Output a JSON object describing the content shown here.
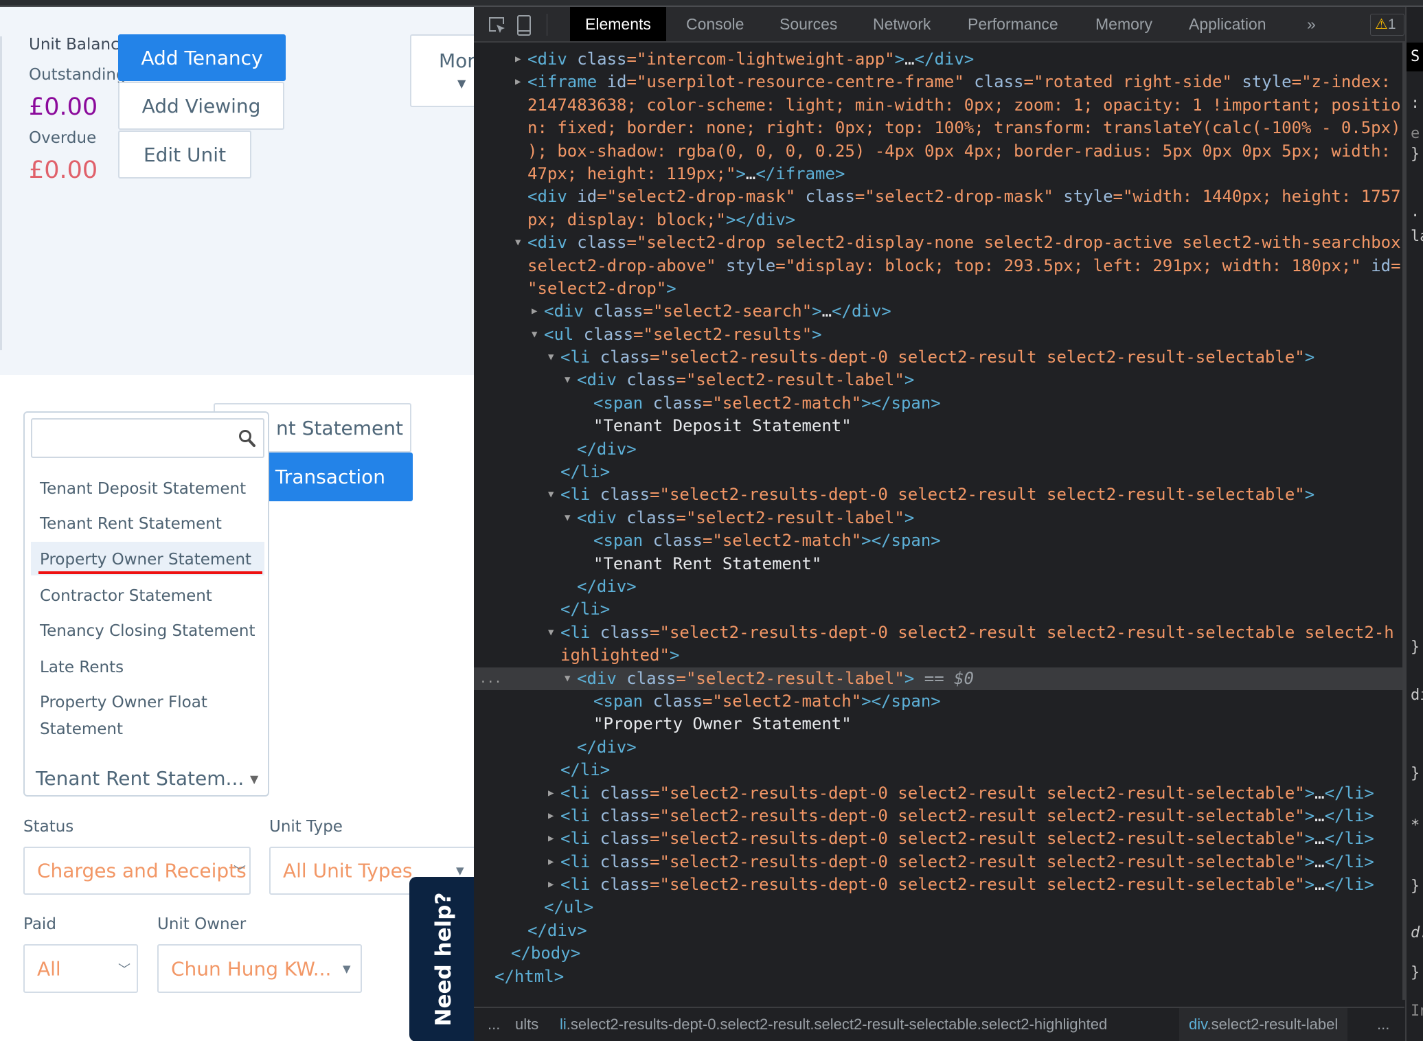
{
  "app": {
    "unit_balance_label": "Unit Balanc",
    "outstanding_label": "Outstanding",
    "outstanding_value": "£0.00",
    "overdue_label": "Overdue",
    "overdue_value": "£0.00",
    "buttons": {
      "add_tenancy": "Add Tenancy",
      "add_viewing": "Add Viewing",
      "edit_unit": "Edit Unit",
      "more": "Mor",
      "statement_partial": "nt Statement",
      "transaction_partial": "d Transaction"
    },
    "colors": {
      "accent": "#2383e8",
      "outstanding": "#8b0a9b",
      "overdue": "#e0606a",
      "help_tab": "#0c2341",
      "annotation_underline": "#ee1111"
    },
    "report_dropdown": {
      "search_placeholder": "",
      "options": [
        "Tenant Deposit Statement",
        "Tenant Rent Statement",
        "Property Owner Statement",
        "Contractor Statement",
        "Tenancy Closing Statement",
        "Late Rents",
        "Property Owner Float Statement"
      ],
      "highlighted": "Property Owner Statement",
      "selected": "Tenant Rent Statem..."
    },
    "filters": {
      "status": {
        "label": "Status",
        "value": "Charges and Receipts"
      },
      "unit_type": {
        "label": "Unit Type",
        "value": "All Unit Types"
      },
      "paid": {
        "label": "Paid",
        "value": "All"
      },
      "unit_owner": {
        "label": "Unit Owner",
        "value": "Chun Hung KW..."
      }
    },
    "need_help": "Need help?"
  },
  "devtools": {
    "tabs": [
      "Elements",
      "Console",
      "Sources",
      "Network",
      "Performance",
      "Memory",
      "Application"
    ],
    "active_tab": "Elements",
    "more_tabs": "»",
    "warning_count": "1",
    "dom_lines": [
      {
        "d": 2,
        "ar": "c",
        "tk": [
          [
            "t",
            "<div"
          ],
          [
            "a",
            " class"
          ],
          [
            "v",
            "=\"intercom-lightweight-app\""
          ],
          [
            "t",
            ">"
          ],
          [
            "x",
            "…"
          ],
          [
            "t",
            "</div>"
          ]
        ]
      },
      {
        "d": 2,
        "ar": "c",
        "tk": [
          [
            "t",
            "<iframe"
          ],
          [
            "a",
            " id"
          ],
          [
            "v",
            "=\"userpilot-resource-centre-frame\""
          ],
          [
            "a",
            " class"
          ],
          [
            "v",
            "=\"rotated right-side\""
          ],
          [
            "a",
            " style"
          ],
          [
            "v",
            "=\"z-index:"
          ]
        ]
      },
      {
        "d": 2,
        "tk": [
          [
            "v",
            "2147483638; color-scheme: light; min-width: 0px; zoom: 1; opacity: 1 !important; positio"
          ]
        ]
      },
      {
        "d": 2,
        "tk": [
          [
            "v",
            "n: fixed; border: none; right: 0px; top: 100%; transform: translateY(calc(-100% - 0.5px)"
          ]
        ]
      },
      {
        "d": 2,
        "tk": [
          [
            "v",
            "); box-shadow: rgba(0, 0, 0, 0.25) -4px 0px 4px; border-radius: 5px 0px 0px 5px; width:"
          ]
        ]
      },
      {
        "d": 2,
        "tk": [
          [
            "v",
            "47px; height: 119px;\""
          ],
          [
            "t",
            ">"
          ],
          [
            "x",
            "…"
          ],
          [
            "t",
            "</iframe>"
          ]
        ]
      },
      {
        "d": 2,
        "tk": [
          [
            "t",
            "<div"
          ],
          [
            "a",
            " id"
          ],
          [
            "v",
            "=\"select2-drop-mask\""
          ],
          [
            "a",
            " class"
          ],
          [
            "v",
            "=\"select2-drop-mask\""
          ],
          [
            "a",
            " style"
          ],
          [
            "v",
            "=\"width: 1440px; height: 1757"
          ]
        ]
      },
      {
        "d": 2,
        "tk": [
          [
            "v",
            "px; display: block;\""
          ],
          [
            "t",
            "></div>"
          ]
        ]
      },
      {
        "d": 2,
        "ar": "e",
        "tk": [
          [
            "t",
            "<div"
          ],
          [
            "a",
            " class"
          ],
          [
            "v",
            "=\"select2-drop select2-display-none select2-drop-active select2-with-searchbox"
          ]
        ]
      },
      {
        "d": 2,
        "tk": [
          [
            "v",
            "select2-drop-above\""
          ],
          [
            "a",
            " style"
          ],
          [
            "v",
            "=\"display: block; top: 293.5px; left: 291px; width: 180px;\""
          ],
          [
            "a",
            " id"
          ],
          [
            "v",
            "="
          ]
        ]
      },
      {
        "d": 2,
        "tk": [
          [
            "v",
            "\"select2-drop\""
          ],
          [
            "t",
            ">"
          ]
        ]
      },
      {
        "d": 3,
        "ar": "c",
        "tk": [
          [
            "t",
            "<div"
          ],
          [
            "a",
            " class"
          ],
          [
            "v",
            "=\"select2-search\""
          ],
          [
            "t",
            ">"
          ],
          [
            "x",
            "…"
          ],
          [
            "t",
            "</div>"
          ]
        ]
      },
      {
        "d": 3,
        "ar": "e",
        "tk": [
          [
            "t",
            "<ul"
          ],
          [
            "a",
            " class"
          ],
          [
            "v",
            "=\"select2-results\""
          ],
          [
            "t",
            ">"
          ]
        ]
      },
      {
        "d": 4,
        "ar": "e",
        "tk": [
          [
            "t",
            "<li"
          ],
          [
            "a",
            " class"
          ],
          [
            "v",
            "=\"select2-results-dept-0 select2-result select2-result-selectable\""
          ],
          [
            "t",
            ">"
          ]
        ]
      },
      {
        "d": 5,
        "ar": "e",
        "tk": [
          [
            "t",
            "<div"
          ],
          [
            "a",
            " class"
          ],
          [
            "v",
            "=\"select2-result-label\""
          ],
          [
            "t",
            ">"
          ]
        ]
      },
      {
        "d": 6,
        "tk": [
          [
            "t",
            "<span"
          ],
          [
            "a",
            " class"
          ],
          [
            "v",
            "=\"select2-match\""
          ],
          [
            "t",
            "></span>"
          ]
        ]
      },
      {
        "d": 6,
        "tk": [
          [
            "x",
            "\"Tenant Deposit Statement\""
          ]
        ]
      },
      {
        "d": 5,
        "tk": [
          [
            "t",
            "</div>"
          ]
        ]
      },
      {
        "d": 4,
        "tk": [
          [
            "t",
            "</li>"
          ]
        ]
      },
      {
        "d": 4,
        "ar": "e",
        "tk": [
          [
            "t",
            "<li"
          ],
          [
            "a",
            " class"
          ],
          [
            "v",
            "=\"select2-results-dept-0 select2-result select2-result-selectable\""
          ],
          [
            "t",
            ">"
          ]
        ]
      },
      {
        "d": 5,
        "ar": "e",
        "tk": [
          [
            "t",
            "<div"
          ],
          [
            "a",
            " class"
          ],
          [
            "v",
            "=\"select2-result-label\""
          ],
          [
            "t",
            ">"
          ]
        ]
      },
      {
        "d": 6,
        "tk": [
          [
            "t",
            "<span"
          ],
          [
            "a",
            " class"
          ],
          [
            "v",
            "=\"select2-match\""
          ],
          [
            "t",
            "></span>"
          ]
        ]
      },
      {
        "d": 6,
        "tk": [
          [
            "x",
            "\"Tenant Rent Statement\""
          ]
        ]
      },
      {
        "d": 5,
        "tk": [
          [
            "t",
            "</div>"
          ]
        ]
      },
      {
        "d": 4,
        "tk": [
          [
            "t",
            "</li>"
          ]
        ]
      },
      {
        "d": 4,
        "ar": "e",
        "tk": [
          [
            "t",
            "<li"
          ],
          [
            "a",
            " class"
          ],
          [
            "v",
            "=\"select2-results-dept-0 select2-result select2-result-selectable select2-h"
          ]
        ]
      },
      {
        "d": 4,
        "tk": [
          [
            "v",
            "ighlighted\""
          ],
          [
            "t",
            ">"
          ]
        ]
      },
      {
        "d": 5,
        "ar": "e",
        "sel": true,
        "tk": [
          [
            "t",
            "<div"
          ],
          [
            "a",
            " class"
          ],
          [
            "v",
            "=\"select2-result-label\""
          ],
          [
            "t",
            ">"
          ],
          [
            "s",
            " == $0"
          ]
        ]
      },
      {
        "d": 6,
        "tk": [
          [
            "t",
            "<span"
          ],
          [
            "a",
            " class"
          ],
          [
            "v",
            "=\"select2-match\""
          ],
          [
            "t",
            "></span>"
          ]
        ]
      },
      {
        "d": 6,
        "tk": [
          [
            "x",
            "\"Property Owner Statement\""
          ]
        ]
      },
      {
        "d": 5,
        "tk": [
          [
            "t",
            "</div>"
          ]
        ]
      },
      {
        "d": 4,
        "tk": [
          [
            "t",
            "</li>"
          ]
        ]
      },
      {
        "d": 4,
        "ar": "c",
        "tk": [
          [
            "t",
            "<li"
          ],
          [
            "a",
            " class"
          ],
          [
            "v",
            "=\"select2-results-dept-0 select2-result select2-result-selectable\""
          ],
          [
            "t",
            ">"
          ],
          [
            "x",
            "…"
          ],
          [
            "t",
            "</li>"
          ]
        ]
      },
      {
        "d": 4,
        "ar": "c",
        "tk": [
          [
            "t",
            "<li"
          ],
          [
            "a",
            " class"
          ],
          [
            "v",
            "=\"select2-results-dept-0 select2-result select2-result-selectable\""
          ],
          [
            "t",
            ">"
          ],
          [
            "x",
            "…"
          ],
          [
            "t",
            "</li>"
          ]
        ]
      },
      {
        "d": 4,
        "ar": "c",
        "tk": [
          [
            "t",
            "<li"
          ],
          [
            "a",
            " class"
          ],
          [
            "v",
            "=\"select2-results-dept-0 select2-result select2-result-selectable\""
          ],
          [
            "t",
            ">"
          ],
          [
            "x",
            "…"
          ],
          [
            "t",
            "</li>"
          ]
        ]
      },
      {
        "d": 4,
        "ar": "c",
        "tk": [
          [
            "t",
            "<li"
          ],
          [
            "a",
            " class"
          ],
          [
            "v",
            "=\"select2-results-dept-0 select2-result select2-result-selectable\""
          ],
          [
            "t",
            ">"
          ],
          [
            "x",
            "…"
          ],
          [
            "t",
            "</li>"
          ]
        ]
      },
      {
        "d": 4,
        "ar": "c",
        "tk": [
          [
            "t",
            "<li"
          ],
          [
            "a",
            " class"
          ],
          [
            "v",
            "=\"select2-results-dept-0 select2-result select2-result-selectable\""
          ],
          [
            "t",
            ">"
          ],
          [
            "x",
            "…"
          ],
          [
            "t",
            "</li>"
          ]
        ]
      },
      {
        "d": 3,
        "tk": [
          [
            "t",
            "</ul>"
          ]
        ]
      },
      {
        "d": 2,
        "tk": [
          [
            "t",
            "</div>"
          ]
        ]
      },
      {
        "d": 1,
        "tk": [
          [
            "t",
            "</body>"
          ]
        ]
      },
      {
        "d": 0,
        "tk": [
          [
            "t",
            "</html>"
          ]
        ]
      }
    ],
    "selected_row_marker": "...",
    "breadcrumbs": {
      "lead": "...",
      "seg1": "ults",
      "seg2_tag": "li",
      "seg2_rest": ".select2-results-dept-0.select2-result.select2-result-selectable.select2-highlighted",
      "seg3_tag": "div",
      "seg3_rest": ".select2-result-label",
      "trail": "..."
    },
    "styles_fragments": [
      "S",
      ":",
      "e",
      "}",
      ".:",
      "la",
      "}",
      "di",
      "}",
      "*",
      "}",
      "d.",
      "}",
      "In"
    ]
  }
}
